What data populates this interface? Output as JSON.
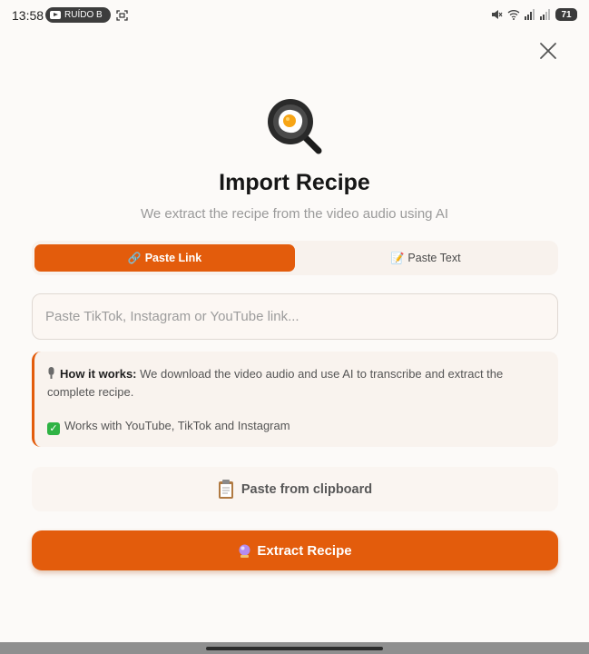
{
  "status_bar": {
    "time": "13:58",
    "media_pill": "RUÍDO B",
    "battery": "71"
  },
  "header": {
    "title": "Import Recipe",
    "subtitle": "We extract the recipe from the video audio using AI"
  },
  "tabs": [
    {
      "emoji": "🔗",
      "label": "Paste Link",
      "active": true
    },
    {
      "emoji": "📝",
      "label": "Paste Text",
      "active": false
    }
  ],
  "link_input": {
    "placeholder": "Paste TikTok, Instagram or YouTube link...",
    "value": ""
  },
  "info": {
    "heading": "How it works:",
    "body": " We download the video audio and use AI to transcribe and extract the complete recipe.",
    "works_with": "Works with YouTube, TikTok and Instagram"
  },
  "actions": {
    "clipboard_label": "Paste from clipboard",
    "extract_label": "Extract Recipe"
  },
  "colors": {
    "accent": "#e35c0c",
    "background": "#fcfaf8",
    "check": "#2fb344"
  }
}
